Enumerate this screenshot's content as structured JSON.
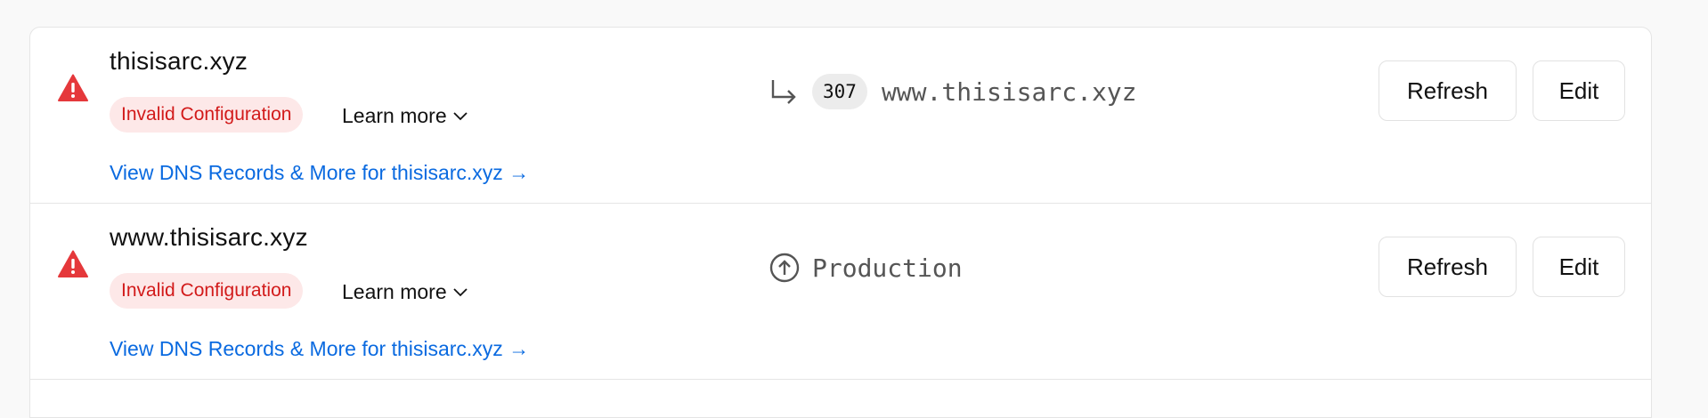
{
  "domains": [
    {
      "name": "thisisarc.xyz",
      "status_badge": "Invalid Configuration",
      "learn_more": "Learn more",
      "dns_link": "View DNS Records & More for thisisarc.xyz →",
      "target": {
        "type": "redirect",
        "status_code": "307",
        "host": "www.thisisarc.xyz"
      },
      "refresh_label": "Refresh",
      "edit_label": "Edit"
    },
    {
      "name": "www.thisisarc.xyz",
      "status_badge": "Invalid Configuration",
      "learn_more": "Learn more",
      "dns_link": "View DNS Records & More for thisisarc.xyz →",
      "target": {
        "type": "environment",
        "label": "Production"
      },
      "refresh_label": "Refresh",
      "edit_label": "Edit"
    }
  ],
  "colors": {
    "warning": "#e5383b",
    "badge_bg": "#fde8e8",
    "badge_text": "#d21a1a",
    "link": "#0a6ae0"
  },
  "icons": {
    "warning": "warning-triangle-icon",
    "redirect": "redirect-arrow-icon",
    "production": "arrow-up-circle-icon",
    "learn_more": "chevron-down-icon"
  }
}
